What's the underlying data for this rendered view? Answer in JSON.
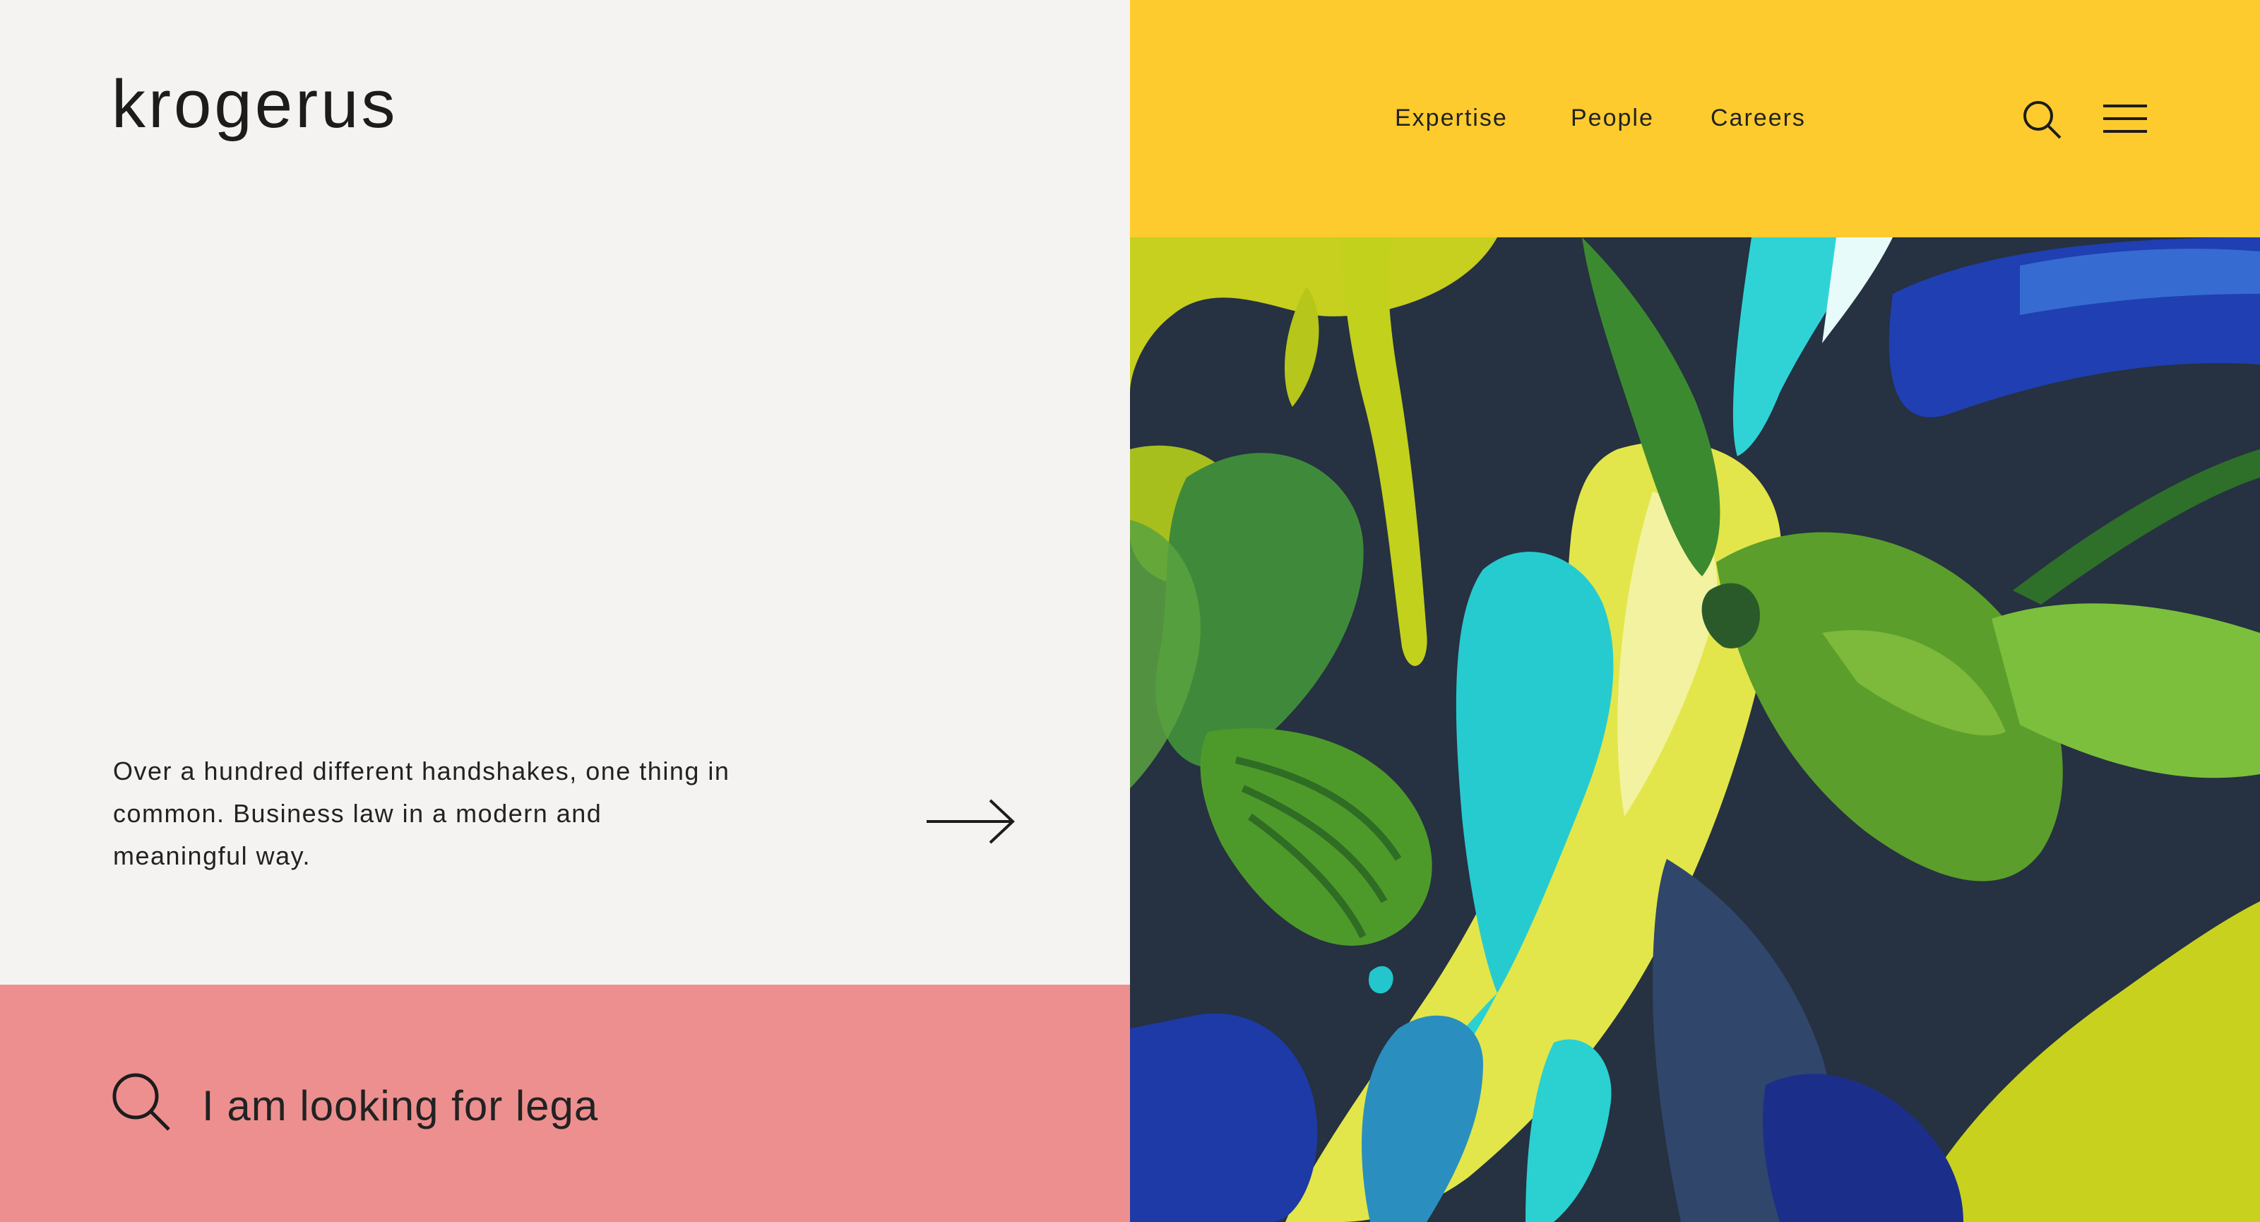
{
  "brand": {
    "logo": "krogerus"
  },
  "nav": {
    "items": [
      "Expertise",
      "People",
      "Careers"
    ]
  },
  "header": {
    "search_icon": "search-icon",
    "menu_icon": "hamburger-menu-icon"
  },
  "hero": {
    "text": "Over a hundred different handshakes, one thing in common. Business law in a modern and meaningful way.",
    "arrow_icon": "arrow-right-icon"
  },
  "search": {
    "value": "I am looking for lega",
    "icon": "search-icon"
  },
  "colors": {
    "background": "#f4f3f1",
    "header_yellow": "#fecb2e",
    "search_pink": "#ed8f8f",
    "text": "#1c1c1c"
  }
}
